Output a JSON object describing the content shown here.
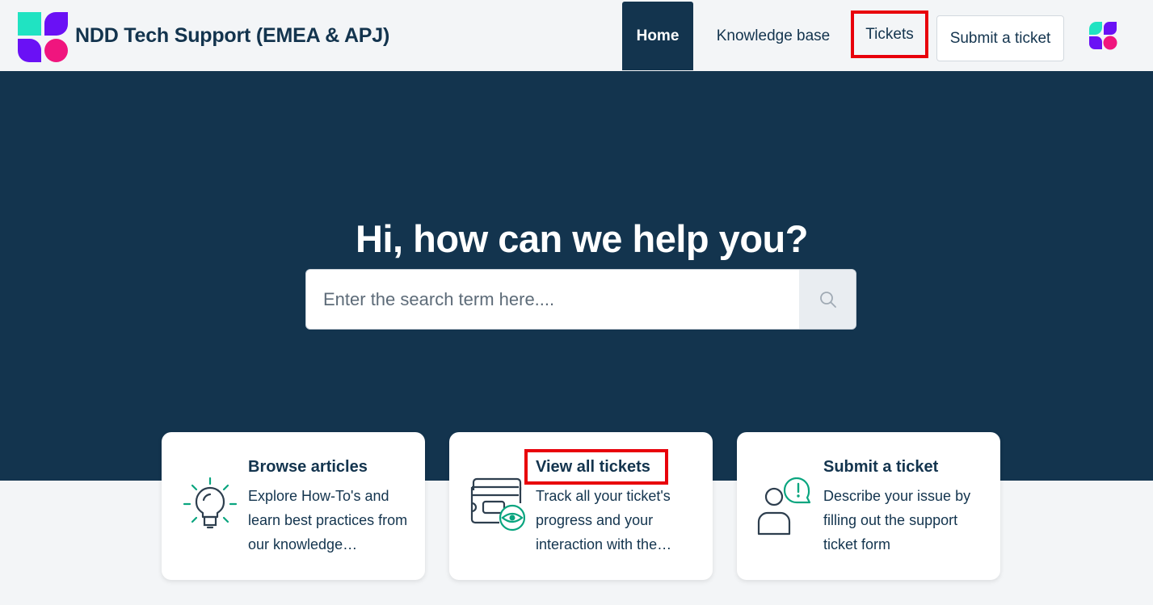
{
  "header": {
    "site_title": "NDD Tech Support (EMEA & APJ)",
    "logo_icon": "ndd-logo-icon",
    "nav": {
      "home": "Home",
      "knowledge_base": "Knowledge base",
      "tickets": "Tickets"
    },
    "submit_button": "Submit a ticket",
    "avatar_icon": "user-avatar-icon"
  },
  "hero": {
    "title": "Hi, how can we help you?",
    "search_placeholder": "Enter the search term here....",
    "search_icon": "search-icon"
  },
  "cards": [
    {
      "title": "Browse articles",
      "description": "Explore How-To's and learn best practices from our knowledge…",
      "icon": "lightbulb-icon"
    },
    {
      "title": "View all tickets",
      "description": "Track all your ticket's progress and your interaction with the…",
      "icon": "ticket-eye-icon"
    },
    {
      "title": "Submit a ticket",
      "description": "Describe your issue by filling out the support ticket form",
      "icon": "user-alert-icon"
    }
  ],
  "colors": {
    "navy": "#13344e",
    "accent_teal": "#0aa57f",
    "highlight_red": "#e8000b",
    "logo_teal": "#20e3c2",
    "logo_purple": "#6a11f5",
    "logo_pink": "#f0157e"
  }
}
